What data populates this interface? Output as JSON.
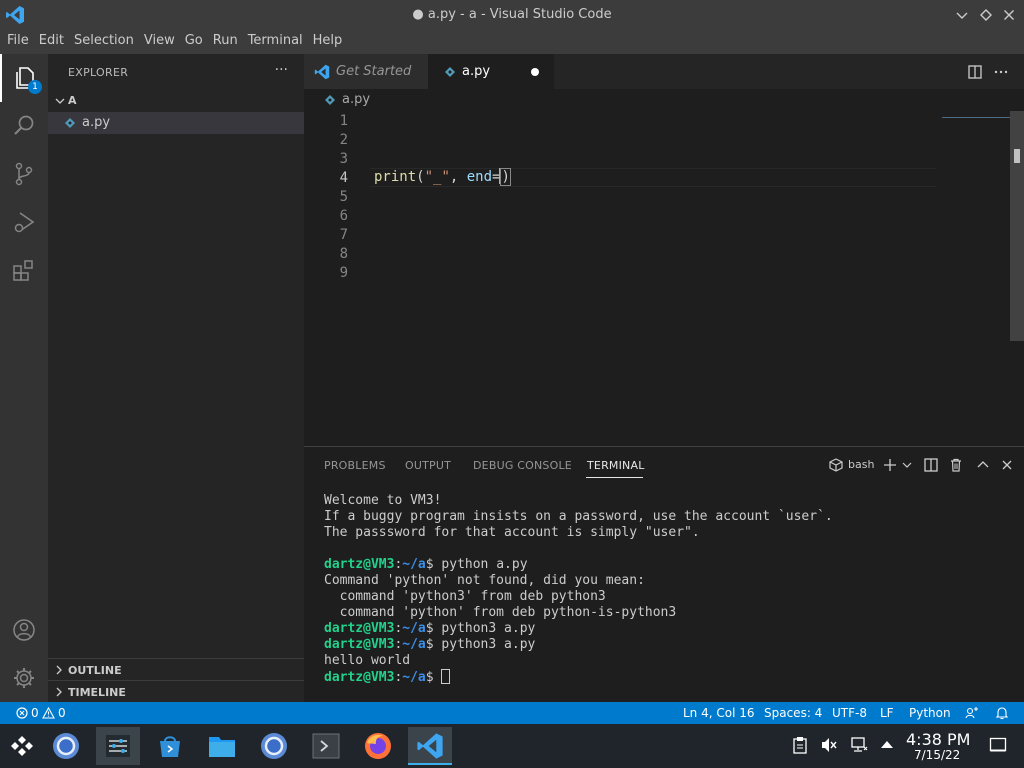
{
  "window": {
    "title": "● a.py - a - Visual Studio Code"
  },
  "menu": [
    "File",
    "Edit",
    "Selection",
    "View",
    "Go",
    "Run",
    "Terminal",
    "Help"
  ],
  "activity_bar": {
    "explorer_badge": "1"
  },
  "sidebar": {
    "header": "EXPLORER",
    "more": "···",
    "folder": "A",
    "file": "a.py",
    "outline": "OUTLINE",
    "timeline": "TIMELINE"
  },
  "tabs": [
    {
      "label": "Get Started"
    },
    {
      "label": "a.py"
    }
  ],
  "breadcrumb": {
    "file": "a.py"
  },
  "editor": {
    "line_numbers": [
      "1",
      "2",
      "3",
      "4",
      "5",
      "6",
      "7",
      "8",
      "9"
    ],
    "current_line": 4,
    "code_line4": {
      "fn": "print",
      "open": "(",
      "str": "\"_\"",
      "sep": ", ",
      "param": "end",
      "eq": "=",
      "close": ")"
    }
  },
  "panel": {
    "tabs": [
      "PROBLEMS",
      "OUTPUT",
      "DEBUG CONSOLE",
      "TERMINAL"
    ],
    "active_tab": "TERMINAL",
    "shell": "bash"
  },
  "terminal": {
    "motd": [
      "Welcome to VM3!",
      "If a buggy program insists on a password, use the account `user`.",
      "The passsword for that account is simply \"user\"."
    ],
    "prompt_user": "dartz@VM3",
    "prompt_sep": ":",
    "prompt_path": "~/a",
    "prompt_end": "$ ",
    "cmd1": "python a.py",
    "out1": [
      "Command 'python' not found, did you mean:",
      "  command 'python3' from deb python3",
      "  command 'python' from deb python-is-python3"
    ],
    "cmd2": "python3 a.py",
    "cmd3": "python3 a.py",
    "out3": "hello world"
  },
  "statusbar": {
    "errors": "0",
    "warnings": "0",
    "position": "Ln 4, Col 16",
    "spaces": "Spaces: 4",
    "encoding": "UTF-8",
    "eol": "LF",
    "language": "Python"
  },
  "taskbar": {
    "time": "4:38 PM",
    "date": "7/15/22"
  },
  "colors": {
    "accent": "#007acc",
    "titlebar": "#3c3c3c",
    "sidebar": "#252526",
    "editor": "#1e1e1e",
    "terminal_user": "#23d18b",
    "terminal_path": "#3b8eea"
  }
}
